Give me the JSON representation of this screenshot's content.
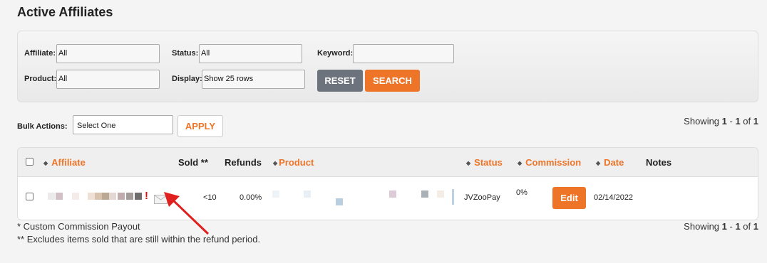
{
  "page": {
    "title": "Active Affiliates"
  },
  "filters": {
    "affiliate_label": "Affiliate:",
    "affiliate_value": "All",
    "status_label": "Status:",
    "status_value": "All",
    "keyword_label": "Keyword:",
    "keyword_value": "",
    "product_label": "Product:",
    "product_value": "All",
    "display_label": "Display:",
    "display_value": "Show 25 rows",
    "reset_label": "RESET",
    "search_label": "SEARCH"
  },
  "bulk": {
    "label": "Bulk Actions:",
    "select_value": "Select One",
    "apply_label": "APPLY"
  },
  "pagination": {
    "prefix": "Showing ",
    "from": "1",
    "sep": " - ",
    "to": "1",
    "of": " of ",
    "total": "1"
  },
  "table": {
    "headers": {
      "affiliate": "Affiliate",
      "sold": "Sold **",
      "refunds": "Refunds",
      "product": "Product",
      "status": "Status",
      "commission": "Commission",
      "date": "Date",
      "notes": "Notes"
    },
    "rows": [
      {
        "sold": "<10",
        "refunds": "0.00%",
        "status": "JVZooPay",
        "commission": "0%",
        "action": "Edit",
        "date": "02/14/2022",
        "flag": "!"
      }
    ]
  },
  "footnotes": {
    "custom": "* Custom Commission Payout",
    "excludes": "** Excludes items sold that are still within the refund period."
  },
  "icons": {
    "envelope": "envelope-icon",
    "sort": "sort-icon",
    "annotation_arrow": "red-arrow"
  },
  "colors": {
    "accent": "#ee7428",
    "reset": "#6c737c",
    "flag": "#dd1111",
    "arrow": "#e0201e"
  }
}
